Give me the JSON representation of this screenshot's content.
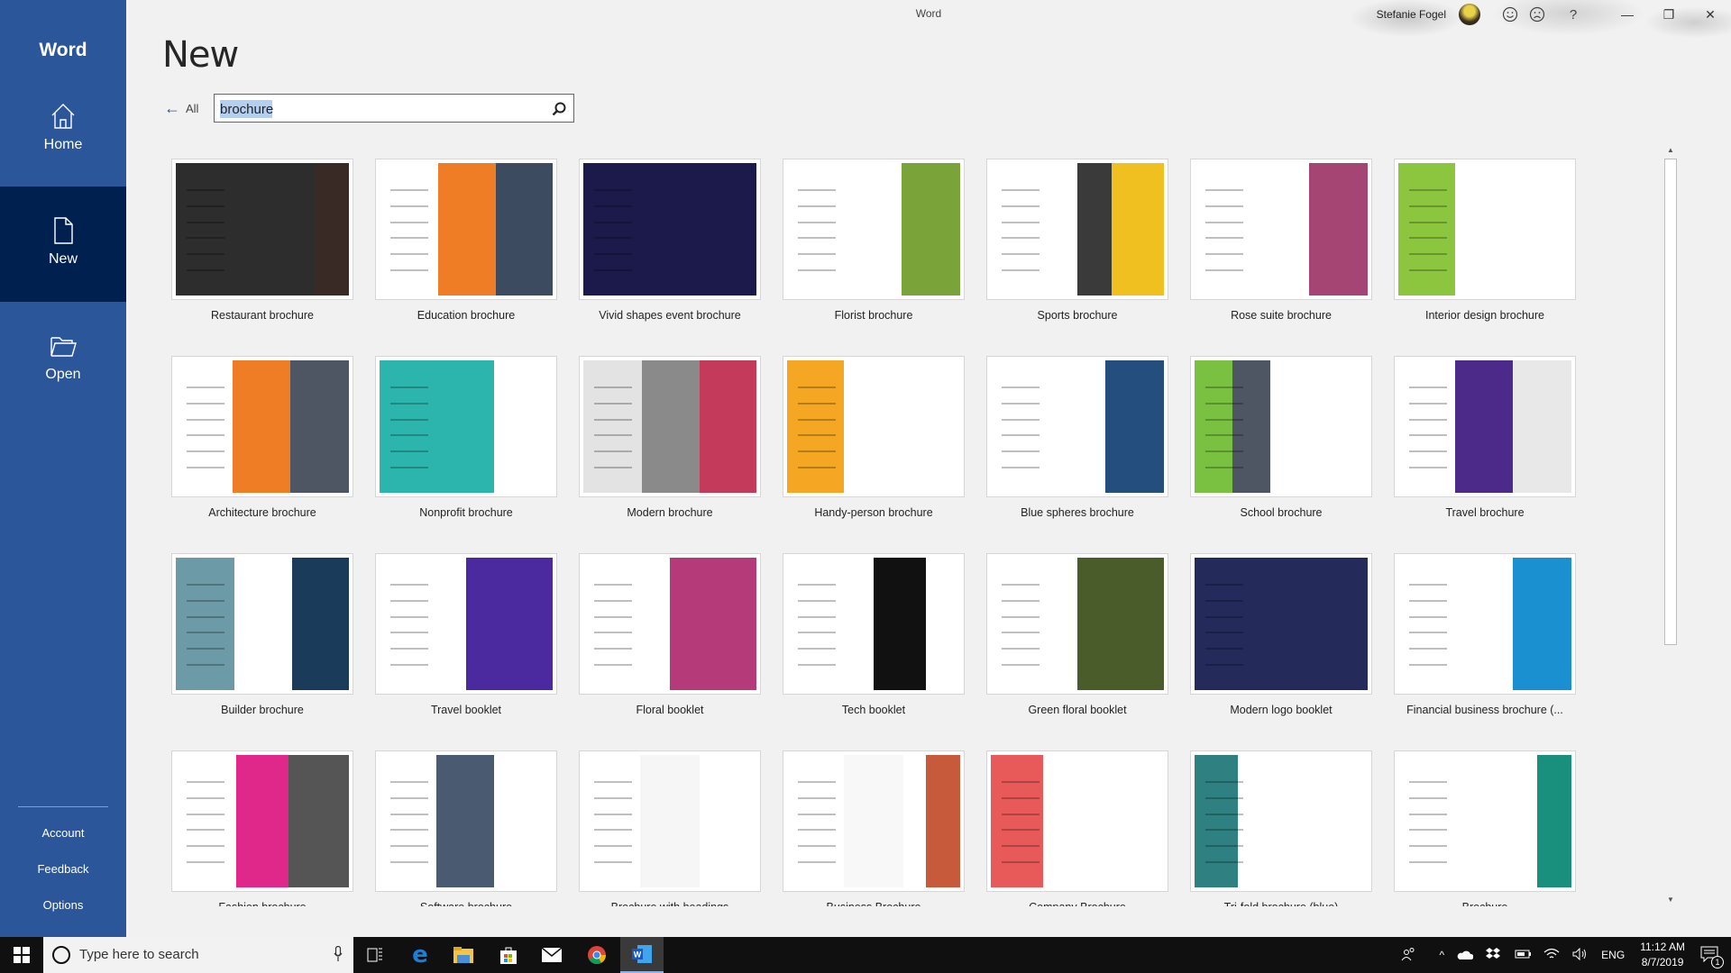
{
  "window": {
    "title": "Word",
    "user_name": "Stefanie Fogel",
    "icons": [
      "avatar",
      "smile-feedback-icon",
      "frown-feedback-icon",
      "help-icon"
    ],
    "controls": {
      "minimize": "—",
      "restore": "❐",
      "close": "✕"
    },
    "help_label": "?"
  },
  "sidebar": {
    "app_name": "Word",
    "items": [
      {
        "label": "Home",
        "icon": "home-icon",
        "active": false
      },
      {
        "label": "New",
        "icon": "new-document-icon",
        "active": true
      },
      {
        "label": "Open",
        "icon": "open-folder-icon",
        "active": false
      }
    ],
    "bottom_links": [
      {
        "label": "Account"
      },
      {
        "label": "Feedback"
      },
      {
        "label": "Options"
      }
    ]
  },
  "main": {
    "page_title": "New",
    "back_label": "All",
    "back_icon": "←",
    "search": {
      "value": "brochure",
      "icon": "search-icon"
    },
    "templates": [
      {
        "label": "Restaurant brochure"
      },
      {
        "label": "Education brochure"
      },
      {
        "label": "Vivid shapes event brochure"
      },
      {
        "label": "Florist brochure"
      },
      {
        "label": "Sports brochure"
      },
      {
        "label": "Rose suite brochure"
      },
      {
        "label": "Interior design brochure"
      },
      {
        "label": "Architecture brochure"
      },
      {
        "label": "Nonprofit brochure"
      },
      {
        "label": "Modern brochure"
      },
      {
        "label": "Handy-person brochure"
      },
      {
        "label": "Blue spheres brochure"
      },
      {
        "label": "School brochure"
      },
      {
        "label": "Travel brochure"
      },
      {
        "label": "Builder brochure"
      },
      {
        "label": "Travel booklet"
      },
      {
        "label": "Floral booklet"
      },
      {
        "label": "Tech booklet"
      },
      {
        "label": "Green floral booklet"
      },
      {
        "label": "Modern logo booklet"
      },
      {
        "label": "Financial business brochure (..."
      },
      {
        "label": "Fashion brochure"
      },
      {
        "label": "Software brochure"
      },
      {
        "label": "Brochure with headings"
      },
      {
        "label": "Business Brochure"
      },
      {
        "label": "Company Brochure"
      },
      {
        "label": "Tri-fold brochure (blue)"
      },
      {
        "label": "Brochure"
      }
    ]
  },
  "taskbar": {
    "search_placeholder": "Type here to search",
    "apps": [
      "task-view",
      "edge",
      "file-explorer",
      "store",
      "mail",
      "chrome",
      "word"
    ],
    "language": "ENG",
    "time": "11:12 AM",
    "date": "8/7/2019",
    "notification_count": "1"
  },
  "colors": {
    "sidebar": "#2b579a",
    "sidebar_active": "#002050",
    "background": "#f1f1f1",
    "taskbar": "#101010"
  }
}
